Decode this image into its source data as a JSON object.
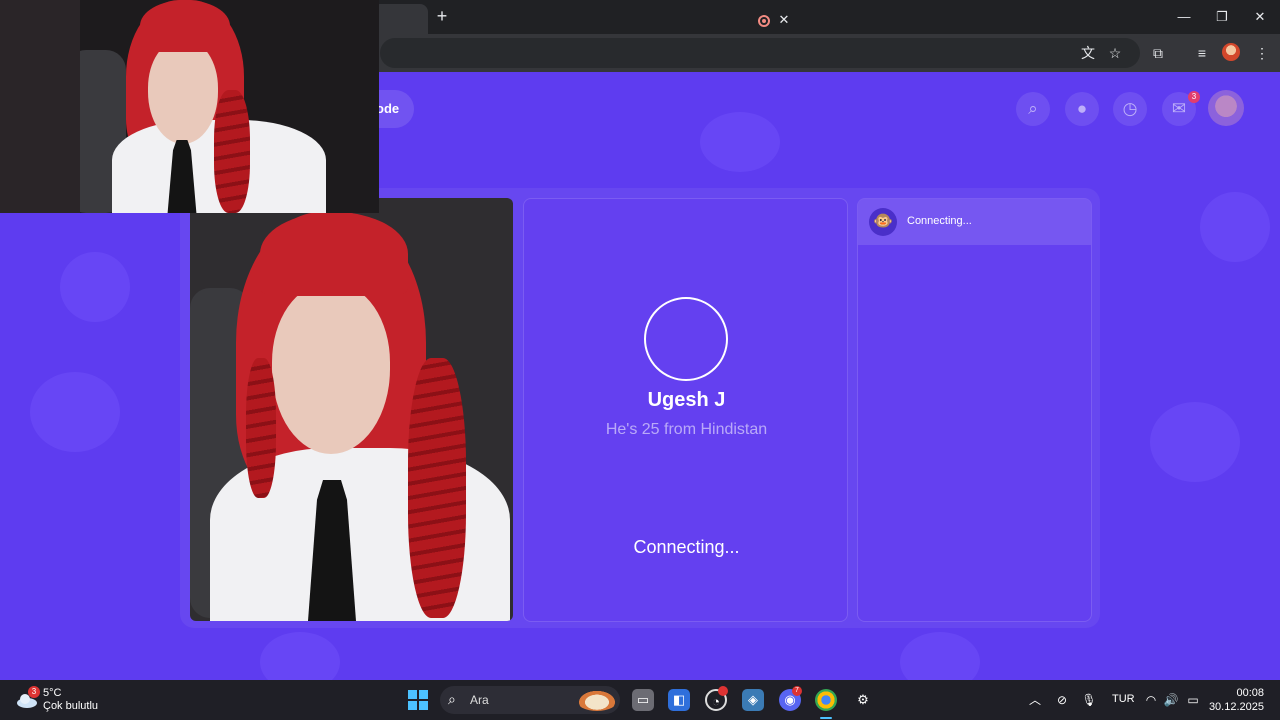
{
  "browser": {
    "tab_close_glyph": "✕",
    "new_tab_glyph": "+",
    "window_controls": {
      "minimize": "—",
      "maximize": "❐",
      "close": "✕"
    },
    "toolbar_icons": [
      "translate-icon",
      "star-icon",
      "extensions-icon",
      "media-icon",
      "profile-avatar",
      "menu-icon"
    ]
  },
  "header": {
    "mode_label": "ode",
    "chat_badge": "3"
  },
  "partner": {
    "name": "Ugesh J",
    "info": "He's 25 from Hindistan",
    "status": "Connecting..."
  },
  "chat": {
    "avatar_emoji": "🐵",
    "status": "Connecting..."
  },
  "taskbar": {
    "weather_badge": "3",
    "weather_temp": "5°C",
    "weather_desc": "Çok bulutlu",
    "search_placeholder": "Ara",
    "discord_badge": "7",
    "language": "TUR",
    "time": "00:08",
    "date": "30.12.2025"
  },
  "colors": {
    "page_bg": "#5e3cf0",
    "card_bg": "#6440f0",
    "accent_badge": "#e23d6e"
  }
}
